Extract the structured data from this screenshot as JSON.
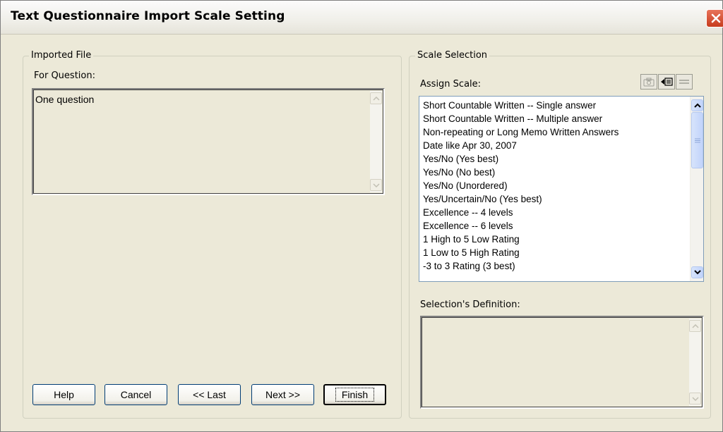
{
  "window": {
    "title": "Text Questionnaire Import Scale Setting"
  },
  "imported": {
    "group_label": "Imported File",
    "question_label": "For Question:",
    "question_text": "One question"
  },
  "scale": {
    "group_label": "Scale Selection",
    "assign_label": "Assign Scale:",
    "items": [
      "Short Countable Written -- Single answer",
      "Short Countable Written -- Multiple answer",
      "Non-repeating or Long Memo Written Answers",
      "Date like Apr 30, 2007",
      "Yes/No (Yes best)",
      "Yes/No (No best)",
      "Yes/No (Unordered)",
      "Yes/Uncertain/No (Yes best)",
      "Excellence -- 4 levels",
      "Excellence -- 6 levels",
      "1 High to 5 Low Rating",
      "1 Low to 5 High Rating",
      "-3 to 3 Rating (3 best)"
    ],
    "definition_label": "Selection's Definition:",
    "definition_text": ""
  },
  "buttons": {
    "help": "Help",
    "cancel": "Cancel",
    "last": "<< Last",
    "next": "Next >>",
    "finish": "Finish"
  },
  "icons": {
    "close": "close-icon",
    "tool1": "camera-icon",
    "tool2": "insert-icon",
    "tool3": "minus-icon"
  },
  "colors": {
    "dialog_bg": "#ece9d8",
    "close_red": "#c73c1e",
    "scroll_blue": "#c1d3fb"
  }
}
